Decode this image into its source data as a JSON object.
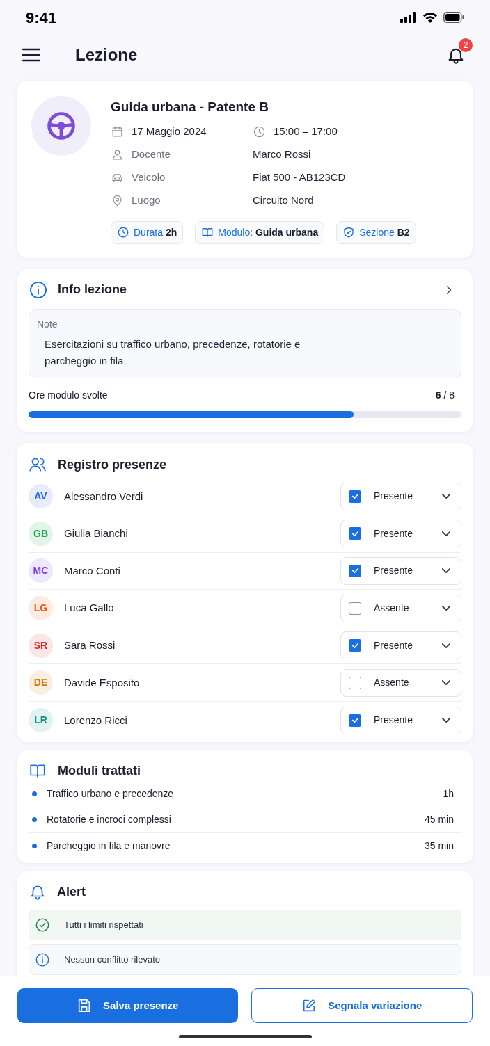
{
  "status_bar": {
    "time": "9:41"
  },
  "header": {
    "title": "Lezione",
    "notifications": "2"
  },
  "lesson": {
    "title": "Guida urbana - Patente B",
    "details": [
      [
        {
          "kind": "value",
          "text": "17 Maggio 2024"
        },
        {
          "kind": "value",
          "text": "15:00 – 17:00"
        }
      ],
      [
        {
          "kind": "label",
          "text": "Docente"
        },
        {
          "kind": "value",
          "text": "Marco Rossi"
        }
      ],
      [
        {
          "kind": "label",
          "text": "Veicolo"
        },
        {
          "kind": "value",
          "text": "Fiat 500 - AB123CD"
        }
      ],
      [
        {
          "kind": "label",
          "text": "Luogo"
        },
        {
          "kind": "value",
          "text": "Circuito Nord"
        }
      ]
    ],
    "chips": [
      {
        "label": "Durata",
        "value": "2h"
      },
      {
        "label": "Modulo:",
        "value": "Guida urbana"
      },
      {
        "label": "Sezione",
        "value": "B2"
      }
    ]
  },
  "info": {
    "title": "Info lezione",
    "note_label": "Note",
    "note": "Esercitazioni su traffico urbano, precedenze, rotatorie e parcheggio in fila.",
    "progress_label": "Ore modulo svolte",
    "done": "6",
    "total": "/ 8",
    "level": 0.75
  },
  "attendance": {
    "title": "Registro presenze",
    "rows": [
      {
        "initials": "AV",
        "name": "Alessandro Verdi",
        "checked": true,
        "status": "Presente",
        "color": "#2563eb"
      },
      {
        "initials": "GB",
        "name": "Giulia Bianchi",
        "checked": true,
        "status": "Presente",
        "color": "#16a34a"
      },
      {
        "initials": "MC",
        "name": "Marco Conti",
        "checked": true,
        "status": "Presente",
        "color": "#7c3aed"
      },
      {
        "initials": "LG",
        "name": "Luca Gallo",
        "checked": false,
        "status": "Assente",
        "color": "#ea580c"
      },
      {
        "initials": "SR",
        "name": "Sara Rossi",
        "checked": true,
        "status": "Presente",
        "color": "#dc2626"
      },
      {
        "initials": "DE",
        "name": "Davide Esposito",
        "checked": false,
        "status": "Assente",
        "color": "#d97706"
      },
      {
        "initials": "LR",
        "name": "Lorenzo Ricci",
        "checked": true,
        "status": "Presente",
        "color": "#0d9488"
      }
    ]
  },
  "modules": {
    "title": "Moduli trattati",
    "items": [
      {
        "name": "Traffico urbano e precedenze",
        "duration": "1h"
      },
      {
        "name": "Rotatorie e incroci complessi",
        "duration": "45 min"
      },
      {
        "name": "Parcheggio in fila e manovre",
        "duration": "35 min"
      }
    ]
  },
  "alerts": {
    "title": "Alert",
    "items": [
      {
        "kind": "success",
        "text": "Tutti i limiti rispettati"
      },
      {
        "kind": "info",
        "text": "Nessun conflitto rilevato"
      }
    ]
  },
  "actions": [
    {
      "kind": "primary",
      "label": "Salva presenze"
    },
    {
      "kind": "secondary",
      "label": "Segnala variazione"
    }
  ]
}
